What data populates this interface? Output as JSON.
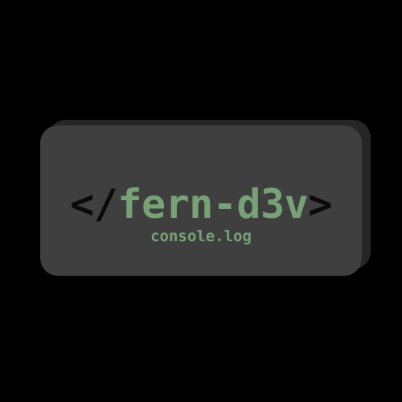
{
  "logo": {
    "open_tag": "</",
    "name": "fern-d3v",
    "close_tag": ">",
    "subtitle": "console.log"
  },
  "colors": {
    "background": "#000000",
    "card": "#3f3f3f",
    "card_shadow": "#262626",
    "accent_green": "#76a276",
    "tag_dark": "#0a0a0a"
  }
}
